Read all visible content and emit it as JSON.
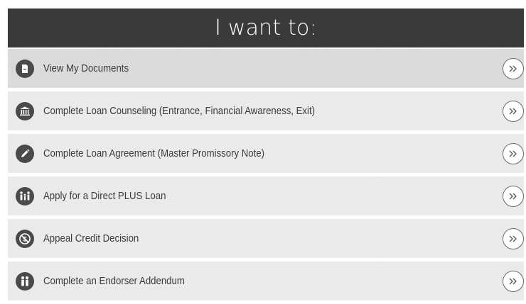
{
  "header": {
    "title": "I want to:"
  },
  "items": [
    {
      "label": "View My Documents",
      "icon": "document-icon"
    },
    {
      "label": "Complete Loan Counseling (Entrance, Financial Awareness, Exit)",
      "icon": "bank-icon"
    },
    {
      "label": "Complete Loan Agreement (Master Promissory Note)",
      "icon": "pencil-icon"
    },
    {
      "label": "Apply for a Direct PLUS Loan",
      "icon": "family-icon"
    },
    {
      "label": "Appeal Credit Decision",
      "icon": "no-dollar-icon"
    },
    {
      "label": "Complete an Endorser Addendum",
      "icon": "people-icon"
    }
  ],
  "colors": {
    "header_bg": "#3a3a3a",
    "header_text": "#ffffff",
    "row_bg": "#ececec",
    "row_bg_first": "#dcdcdc",
    "icon_bg": "#4a4a4a",
    "label_text": "#3b3b3b"
  }
}
